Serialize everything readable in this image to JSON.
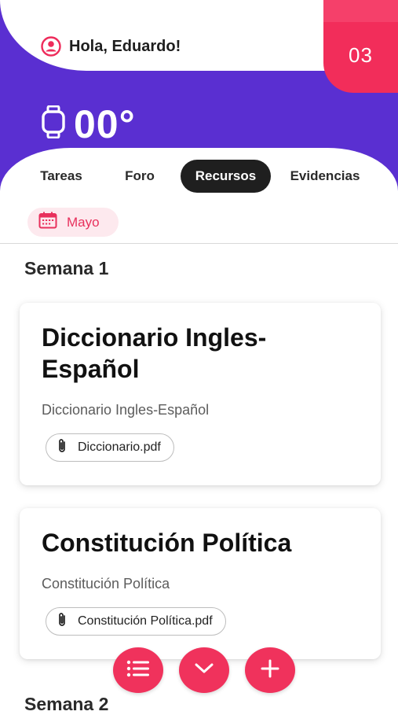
{
  "header": {
    "greeting": "Hola, Eduardo!",
    "badge_number": "03",
    "temperature": "00°",
    "user_icon": "user-circle-icon",
    "watch_icon": "watch-icon"
  },
  "tabs": [
    {
      "label": "Tareas",
      "active": false
    },
    {
      "label": "Foro",
      "active": false
    },
    {
      "label": "Recursos",
      "active": true
    },
    {
      "label": "Evidencias",
      "active": false
    }
  ],
  "month_filter": {
    "label": "Mayo",
    "icon": "calendar-icon"
  },
  "weeks": [
    {
      "title": "Semana 1",
      "resources": [
        {
          "title": "Diccionario Ingles-Español",
          "description": "Diccionario Ingles-Español",
          "attachment": "Diccionario.pdf"
        },
        {
          "title": "Constitución Política",
          "description": "Constitución Política",
          "attachment": "Constitución Política.pdf"
        }
      ]
    },
    {
      "title": "Semana 2",
      "resources": []
    }
  ],
  "fab_buttons": [
    {
      "icon": "list-icon"
    },
    {
      "icon": "chevron-down-icon"
    },
    {
      "icon": "plus-icon"
    }
  ],
  "colors": {
    "primary_purple": "#5a2fd1",
    "accent_pink": "#f0325c",
    "chip_bg": "#fde9ee",
    "active_tab": "#1f1f1f"
  }
}
